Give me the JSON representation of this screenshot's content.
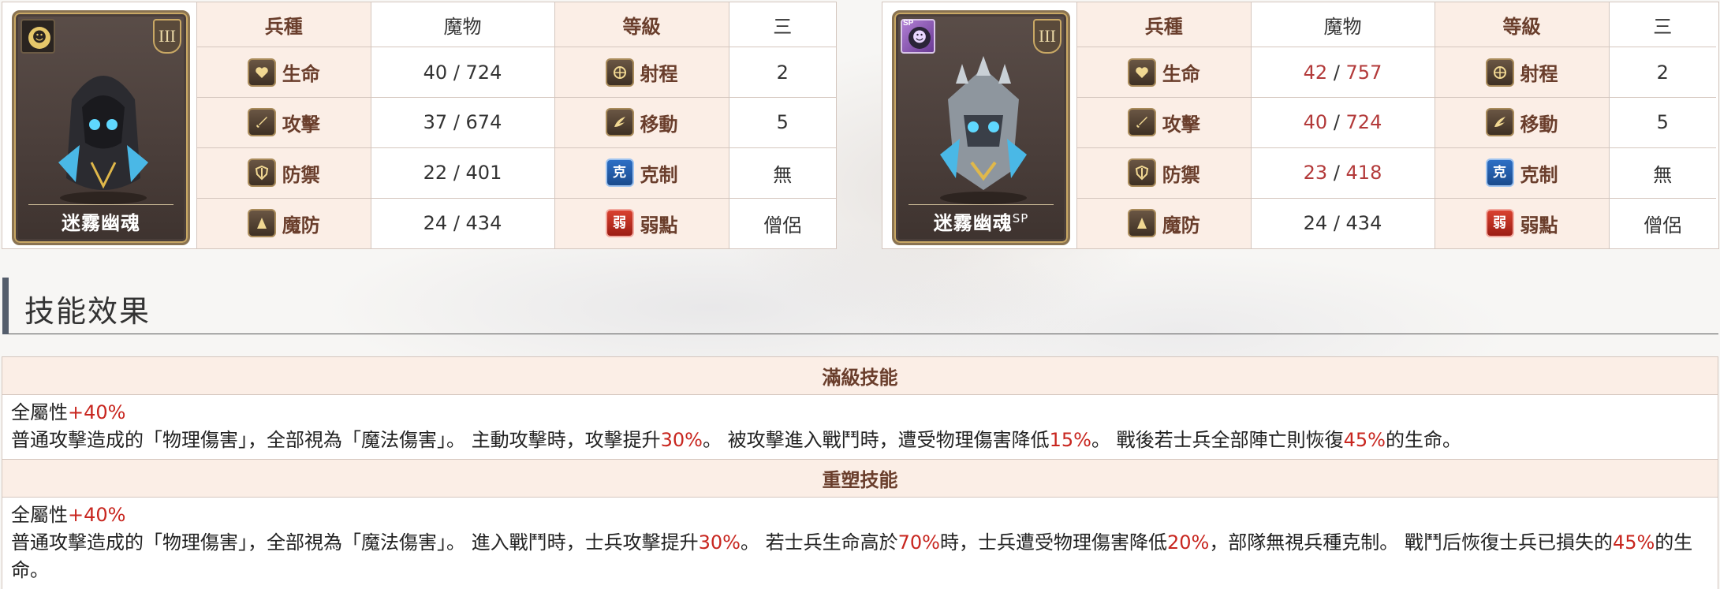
{
  "units": [
    {
      "id": "left",
      "name": "迷霧幽魂",
      "name_sup": "",
      "rank": "III",
      "badge_icon": "cat-face-icon",
      "sp_tag": "",
      "header": {
        "type_label": "兵種",
        "type_value": "魔物",
        "level_label": "等級",
        "level_value": "三"
      },
      "rows": [
        {
          "left_label": "生命",
          "left_icon": "heart-icon",
          "left_a": "40",
          "left_b": "724",
          "left_boost": false,
          "right_label": "射程",
          "right_icon": "crosshair-icon",
          "right_value": "2"
        },
        {
          "left_label": "攻擊",
          "left_icon": "sword-icon",
          "left_a": "37",
          "left_b": "674",
          "left_boost": false,
          "right_label": "移動",
          "right_icon": "wing-icon",
          "right_value": "5"
        },
        {
          "left_label": "防禦",
          "left_icon": "shield-icon",
          "left_a": "22",
          "left_b": "401",
          "left_boost": false,
          "right_label": "克制",
          "right_icon": "counter-icon",
          "right_value": "無"
        },
        {
          "left_label": "魔防",
          "left_icon": "hood-icon",
          "left_a": "24",
          "left_b": "434",
          "left_boost": false,
          "right_label": "弱點",
          "right_icon": "weakness-icon",
          "right_value": "僧侶"
        }
      ]
    },
    {
      "id": "right",
      "name": "迷霧幽魂",
      "name_sup": "SP",
      "rank": "III",
      "badge_icon": "cat-face-icon",
      "sp_tag": "SP",
      "header": {
        "type_label": "兵種",
        "type_value": "魔物",
        "level_label": "等級",
        "level_value": "三"
      },
      "rows": [
        {
          "left_label": "生命",
          "left_icon": "heart-icon",
          "left_a": "42",
          "left_b": "757",
          "left_boost": true,
          "right_label": "射程",
          "right_icon": "crosshair-icon",
          "right_value": "2"
        },
        {
          "left_label": "攻擊",
          "left_icon": "sword-icon",
          "left_a": "40",
          "left_b": "724",
          "left_boost": true,
          "right_label": "移動",
          "right_icon": "wing-icon",
          "right_value": "5"
        },
        {
          "left_label": "防禦",
          "left_icon": "shield-icon",
          "left_a": "23",
          "left_b": "418",
          "left_boost": true,
          "right_label": "克制",
          "right_icon": "counter-icon",
          "right_value": "無"
        },
        {
          "left_label": "魔防",
          "left_icon": "hood-icon",
          "left_a": "24",
          "left_b": "434",
          "left_boost": false,
          "right_label": "弱點",
          "right_icon": "weakness-icon",
          "right_value": "僧侶"
        }
      ]
    }
  ],
  "icon_glyphs": {
    "counter": "克",
    "weakness": "弱"
  },
  "section": {
    "title": "技能效果"
  },
  "skills": [
    {
      "header": "滿級技能",
      "lines": [
        [
          {
            "t": "全屬性",
            "red": false
          },
          {
            "t": "+40%",
            "red": true
          }
        ],
        [
          {
            "t": "普通攻擊造成的「物理傷害」，全部視為「魔法傷害」。 主動攻擊時，攻擊提升",
            "red": false
          },
          {
            "t": "30%",
            "red": true
          },
          {
            "t": "。 被攻擊進入戰鬥時，遭受物理傷害降低",
            "red": false
          },
          {
            "t": "15%",
            "red": true
          },
          {
            "t": "。 戰後若士兵全部陣亡則恢復",
            "red": false
          },
          {
            "t": "45%",
            "red": true
          },
          {
            "t": "的生命。",
            "red": false
          }
        ]
      ]
    },
    {
      "header": "重塑技能",
      "lines": [
        [
          {
            "t": "全屬性",
            "red": false
          },
          {
            "t": "+40%",
            "red": true
          }
        ],
        [
          {
            "t": "普通攻擊造成的「物理傷害」，全部視為「魔法傷害」。 進入戰鬥時，士兵攻擊提升",
            "red": false
          },
          {
            "t": "30%",
            "red": true
          },
          {
            "t": "。 若士兵生命高於",
            "red": false
          },
          {
            "t": "70%",
            "red": true
          },
          {
            "t": "時，士兵遭受物理傷害降低",
            "red": false
          },
          {
            "t": "20%",
            "red": true
          },
          {
            "t": "，部隊無視兵種克制。 戰鬥后恢復士兵已損失的",
            "red": false
          },
          {
            "t": "45%",
            "red": true
          },
          {
            "t": "的生命。",
            "red": false
          }
        ]
      ]
    }
  ],
  "colors": {
    "label_bg": "#fbeee6",
    "label_text": "#6a3e2c",
    "boost_text": "#b33a3a",
    "highlight_red": "#c8261f",
    "section_bar": "#555e6c"
  }
}
